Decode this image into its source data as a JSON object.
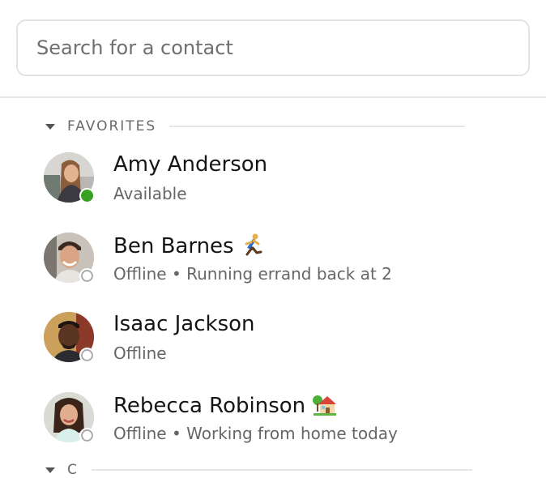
{
  "search": {
    "placeholder": "Search for a contact",
    "value": ""
  },
  "sections": [
    {
      "title": "FAVORITES",
      "contacts": [
        {
          "name": "Amy Anderson",
          "status": "Available",
          "presence": "available",
          "emoji": ""
        },
        {
          "name": "Ben Barnes",
          "status": "Offline • Running errand back at 2",
          "presence": "offline",
          "emoji": "running-person-icon"
        },
        {
          "name": "Isaac Jackson",
          "status": "Offline",
          "presence": "offline",
          "emoji": ""
        },
        {
          "name": "Rebecca Robinson",
          "status": "Offline • Working from home today",
          "presence": "offline",
          "emoji": "house-with-garden-icon"
        }
      ]
    },
    {
      "title": "C",
      "contacts": []
    }
  ],
  "colors": {
    "available": "#36a020",
    "offline_ring": "#a8a8a8",
    "border": "#e3e3e3",
    "section_text": "#6a6a6a"
  }
}
